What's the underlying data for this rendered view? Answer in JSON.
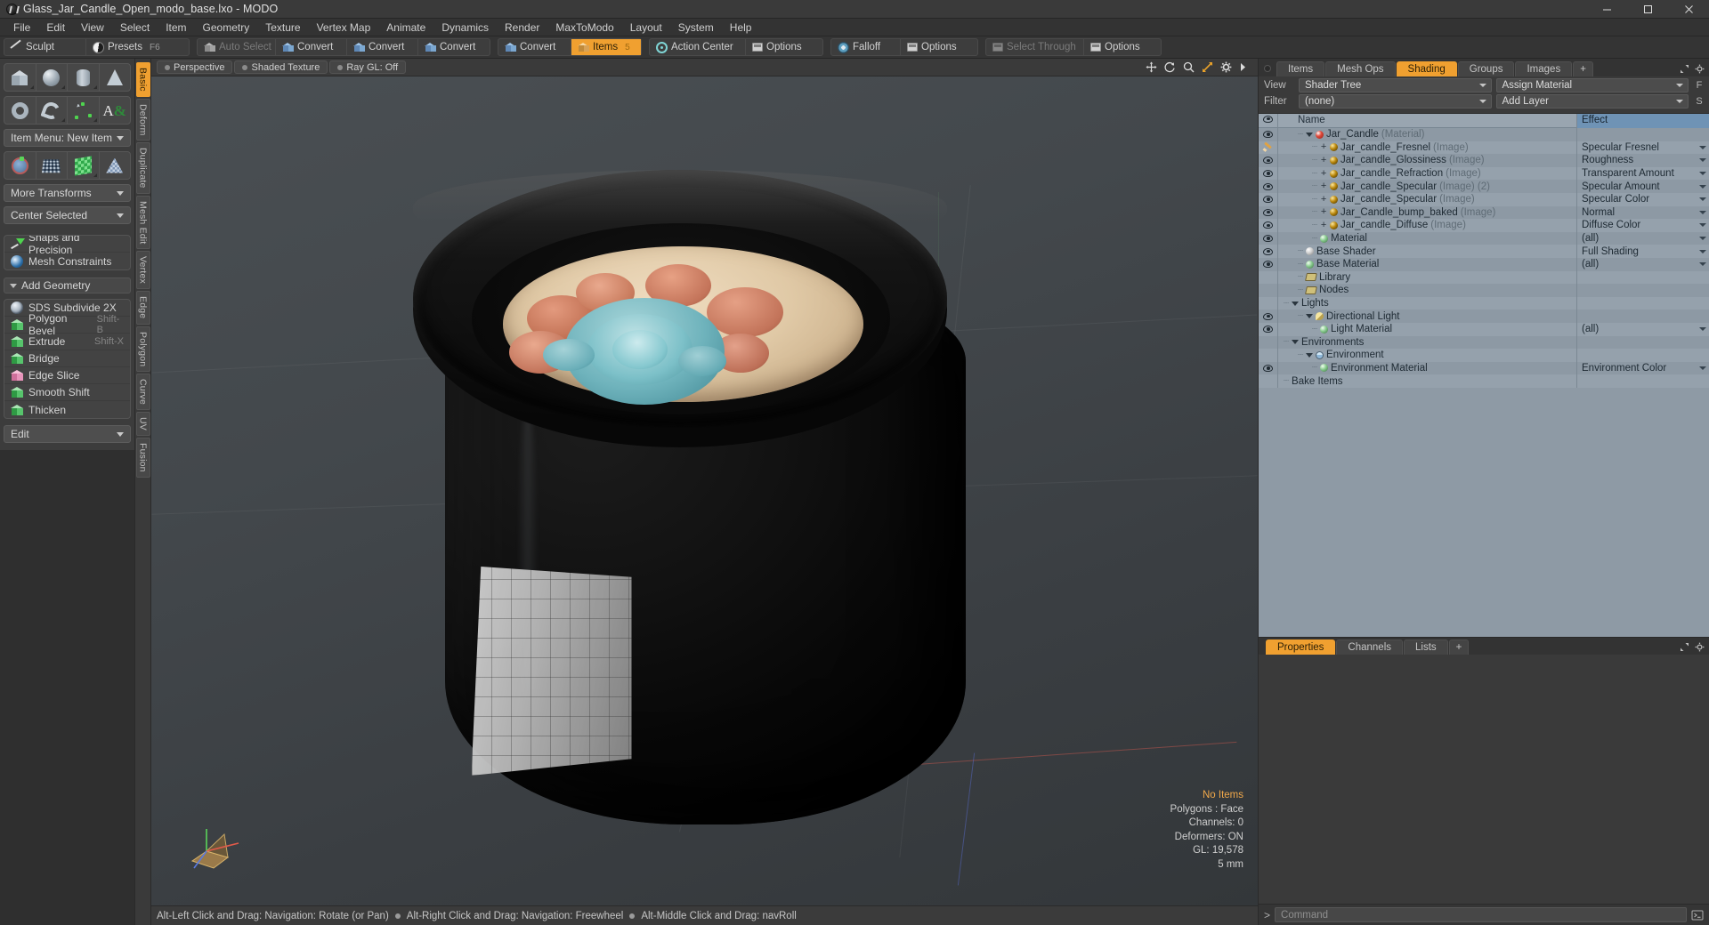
{
  "window": {
    "title": "Glass_Jar_Candle_Open_modo_base.lxo - MODO",
    "logo": "modo-logo-icon",
    "controls": {
      "minimize": "minimize-icon",
      "maximize": "maximize-icon",
      "close": "close-icon"
    }
  },
  "menubar": {
    "items": [
      "File",
      "Edit",
      "View",
      "Select",
      "Item",
      "Geometry",
      "Texture",
      "Vertex Map",
      "Animate",
      "Dynamics",
      "Render",
      "MaxToModo",
      "Layout",
      "System",
      "Help"
    ]
  },
  "toolbar": {
    "group_left": [
      {
        "label": "Sculpt",
        "icon": "sculpt-icon",
        "shortcut": "",
        "state": "normal"
      },
      {
        "label": "Presets",
        "icon": "presets-icon",
        "shortcut": "F6",
        "state": "normal"
      }
    ],
    "group_main": [
      {
        "label": "Auto Select",
        "icon": "cube-grey-icon",
        "shortcut": "",
        "state": "disabled"
      },
      {
        "label": "Convert",
        "icon": "cube-blue-icon",
        "shortcut": "",
        "state": "normal"
      },
      {
        "label": "Convert",
        "icon": "cube-blue-icon",
        "shortcut": "",
        "state": "normal"
      },
      {
        "label": "Convert",
        "icon": "cube-blue-icon",
        "shortcut": "",
        "state": "normal"
      },
      {
        "label": "Convert",
        "icon": "cube-blue-icon",
        "shortcut": "",
        "state": "normal"
      },
      {
        "label": "Items",
        "icon": "cube-orange-icon",
        "shortcut": "5",
        "state": "active"
      },
      {
        "label": "Action Center",
        "icon": "action-center-icon",
        "shortcut": "",
        "state": "normal"
      },
      {
        "label": "Options",
        "icon": "options-icon",
        "shortcut": "",
        "state": "normal"
      },
      {
        "label": "Falloff",
        "icon": "falloff-icon",
        "shortcut": "",
        "state": "normal"
      },
      {
        "label": "Options",
        "icon": "options-icon",
        "shortcut": "",
        "state": "normal"
      },
      {
        "label": "Select Through",
        "icon": "select-through-icon",
        "shortcut": "",
        "state": "disabled"
      },
      {
        "label": "Options",
        "icon": "options-icon",
        "shortcut": "",
        "state": "normal"
      }
    ]
  },
  "left_panel": {
    "primitives_row1": [
      "cube-primitive-icon",
      "sphere-primitive-icon",
      "cylinder-primitive-icon",
      "cone-primitive-icon"
    ],
    "primitives_row2": [
      "torus-primitive-icon",
      "spiral-primitive-icon",
      "polygon-primitive-icon",
      "text-primitive-icon"
    ],
    "item_menu": {
      "label": "Item Menu: New Item",
      "icon": "chevron-down-icon"
    },
    "transform_row": [
      "transform-axis-icon",
      "grid-transform-icon",
      "green-mesh-icon",
      "blue-mesh-icon"
    ],
    "more_transforms": {
      "label": "More Transforms",
      "icon": "chevron-down-icon"
    },
    "center_selected": {
      "label": "Center Selected",
      "icon": "chevron-down-icon"
    },
    "snaps": {
      "label": "Snaps and Precision",
      "icon": "snap-icon"
    },
    "mesh_constraints": {
      "label": "Mesh Constraints",
      "icon": "constraint-icon"
    },
    "add_geometry_header": {
      "label": "Add Geometry",
      "icon": "triangle-down-icon"
    },
    "tools": [
      {
        "label": "SDS Subdivide 2X",
        "shortcut": "",
        "icon": "sds-icon"
      },
      {
        "label": "Polygon Bevel",
        "shortcut": "Shift-B",
        "icon": "green-cube-icon"
      },
      {
        "label": "Extrude",
        "shortcut": "Shift-X",
        "icon": "green-cube-icon"
      },
      {
        "label": "Bridge",
        "shortcut": "",
        "icon": "green-cube-icon"
      },
      {
        "label": "Edge Slice",
        "shortcut": "",
        "icon": "pink-cube-icon"
      },
      {
        "label": "Smooth Shift",
        "shortcut": "",
        "icon": "green-cube-icon"
      },
      {
        "label": "Thicken",
        "shortcut": "",
        "icon": "green-cube-icon"
      }
    ],
    "edit_dropdown": {
      "label": "Edit",
      "icon": "chevron-down-icon"
    }
  },
  "vertical_tabs": {
    "items": [
      {
        "label": "Basic",
        "active": true
      },
      {
        "label": "Deform",
        "active": false
      },
      {
        "label": "Duplicate",
        "active": false
      },
      {
        "label": "Mesh Edit",
        "active": false
      },
      {
        "label": "Vertex",
        "active": false
      },
      {
        "label": "Edge",
        "active": false
      },
      {
        "label": "Polygon",
        "active": false
      },
      {
        "label": "Curve",
        "active": false
      },
      {
        "label": "UV",
        "active": false
      },
      {
        "label": "Fusion",
        "active": false
      }
    ]
  },
  "viewport": {
    "header": {
      "view_mode": "Perspective",
      "shading": "Shaded Texture",
      "raygl": "Ray GL: Off",
      "icons": [
        "move-icon",
        "rotate-icon",
        "zoom-icon",
        "fit-icon",
        "gear-icon",
        "chevron-right-icon"
      ]
    },
    "stats": {
      "selection": "No Items",
      "polygons": "Polygons : Face",
      "channels": "Channels: 0",
      "deformers": "Deformers: ON",
      "gl": "GL: 19,578",
      "scale": "5 mm"
    },
    "gizmo": "axis-gizmo-icon",
    "scene_object": "glass-jar-candle-3d-model"
  },
  "statusbar": {
    "hints": [
      "Alt-Left Click and Drag: Navigation: Rotate (or Pan)",
      "Alt-Right Click and Drag: Navigation: Freewheel",
      "Alt-Middle Click and Drag: navRoll"
    ]
  },
  "right_panel": {
    "tabs": [
      {
        "label": "Items",
        "active": false
      },
      {
        "label": "Mesh Ops",
        "active": false
      },
      {
        "label": "Shading",
        "active": true
      },
      {
        "label": "Groups",
        "active": false
      },
      {
        "label": "Images",
        "active": false
      },
      {
        "label": "+",
        "active": false
      }
    ],
    "view_label": "View",
    "view_value": "Shader Tree",
    "assign_material": "Assign Material",
    "assign_material_side": "F",
    "filter_label": "Filter",
    "filter_value": "(none)",
    "add_layer": "Add Layer",
    "add_layer_side": "S",
    "columns": {
      "eye": "visibility-icon",
      "name": "Name",
      "effect": "Effect"
    },
    "tree": [
      {
        "indent": 1,
        "icon": "sphere-material-icon",
        "name": "Jar_Candle",
        "type": "(Material)",
        "effect": "",
        "eye": "eye",
        "expander": "triangle-down"
      },
      {
        "indent": 2,
        "icon": "sphere-image-icon",
        "name": "Jar_candle_Fresnel",
        "type": "(Image)",
        "effect": "Specular Fresnel",
        "eye": "brush",
        "expander": "plus"
      },
      {
        "indent": 2,
        "icon": "sphere-image-icon",
        "name": "Jar_candle_Glossiness",
        "type": "(Image)",
        "effect": "Roughness",
        "eye": "eye",
        "expander": "plus"
      },
      {
        "indent": 2,
        "icon": "sphere-image-icon",
        "name": "Jar_candle_Refraction",
        "type": "(Image)",
        "effect": "Transparent Amount",
        "eye": "eye",
        "expander": "plus"
      },
      {
        "indent": 2,
        "icon": "sphere-image-icon",
        "name": "Jar_candle_Specular",
        "type": "(Image) (2)",
        "effect": "Specular Amount",
        "eye": "eye",
        "expander": "plus"
      },
      {
        "indent": 2,
        "icon": "sphere-image-icon",
        "name": "Jar_candle_Specular",
        "type": "(Image)",
        "effect": "Specular Color",
        "eye": "eye",
        "expander": "plus"
      },
      {
        "indent": 2,
        "icon": "sphere-image-icon",
        "name": "Jar_Candle_bump_baked",
        "type": "(Image)",
        "effect": "Normal",
        "eye": "eye",
        "expander": "plus"
      },
      {
        "indent": 2,
        "icon": "sphere-image-icon",
        "name": "Jar_candle_Diffuse",
        "type": "(Image)",
        "effect": "Diffuse Color",
        "eye": "eye",
        "expander": "plus"
      },
      {
        "indent": 2,
        "icon": "sphere-green-icon",
        "name": "Material",
        "type": "",
        "effect": "(all)",
        "eye": "eye",
        "expander": "none"
      },
      {
        "indent": 1,
        "icon": "sphere-grey-icon",
        "name": "Base Shader",
        "type": "",
        "effect": "Full Shading",
        "eye": "eye",
        "expander": "none"
      },
      {
        "indent": 1,
        "icon": "sphere-green-icon",
        "name": "Base Material",
        "type": "",
        "effect": "(all)",
        "eye": "eye",
        "expander": "none"
      },
      {
        "indent": 1,
        "icon": "folder-icon",
        "name": "Library",
        "type": "",
        "effect": "",
        "eye": "none",
        "expander": "none"
      },
      {
        "indent": 1,
        "icon": "folder-icon",
        "name": "Nodes",
        "type": "",
        "effect": "",
        "eye": "none",
        "expander": "none"
      },
      {
        "indent": 0,
        "icon": "none",
        "name": "Lights",
        "type": "",
        "effect": "",
        "eye": "none",
        "expander": "triangle-down"
      },
      {
        "indent": 1,
        "icon": "light-icon",
        "name": "Directional Light",
        "type": "",
        "effect": "",
        "eye": "eye",
        "expander": "triangle-down"
      },
      {
        "indent": 2,
        "icon": "sphere-green-icon",
        "name": "Light Material",
        "type": "",
        "effect": "(all)",
        "eye": "eye",
        "expander": "none"
      },
      {
        "indent": 0,
        "icon": "none",
        "name": "Environments",
        "type": "",
        "effect": "",
        "eye": "none",
        "expander": "triangle-down"
      },
      {
        "indent": 1,
        "icon": "environment-icon",
        "name": "Environment",
        "type": "",
        "effect": "",
        "eye": "none",
        "expander": "triangle-down"
      },
      {
        "indent": 2,
        "icon": "sphere-green-icon",
        "name": "Environment Material",
        "type": "",
        "effect": "Environment Color",
        "eye": "eye",
        "expander": "none"
      },
      {
        "indent": 0,
        "icon": "none",
        "name": "Bake Items",
        "type": "",
        "effect": "",
        "eye": "none",
        "expander": "none"
      }
    ],
    "bottom_tabs": [
      {
        "label": "Properties",
        "active": true
      },
      {
        "label": "Channels",
        "active": false
      },
      {
        "label": "Lists",
        "active": false
      },
      {
        "label": "+",
        "active": false
      }
    ],
    "command": {
      "prompt": ">",
      "placeholder": "Command",
      "icon": "command-run-icon"
    }
  },
  "colors": {
    "accent": "#f0a030",
    "panel": "#3a3a3a",
    "tree_bg": "#8e9aa5",
    "effect_header": "#6f93b5",
    "status_highlight": "#f0a84a"
  }
}
